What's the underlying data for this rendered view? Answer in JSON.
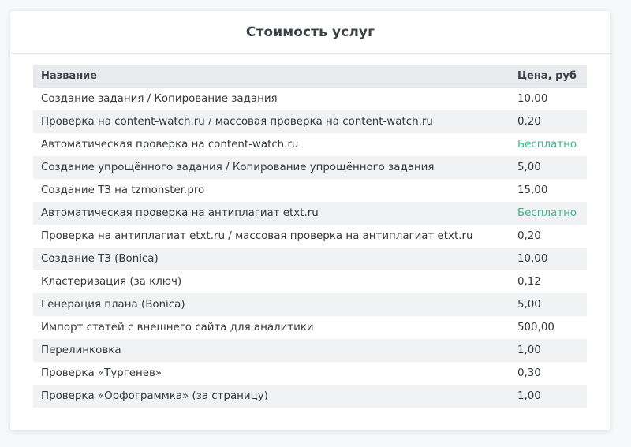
{
  "title": "Стоимость услуг",
  "table": {
    "columns": [
      "Название",
      "Цена, руб"
    ],
    "rows": [
      {
        "name": "Создание задания / Копирование задания",
        "price": "10,00",
        "free": false
      },
      {
        "name": "Проверка на content-watch.ru / массовая проверка на content-watch.ru",
        "price": "0,20",
        "free": false
      },
      {
        "name": "Автоматическая проверка на content-watch.ru",
        "price": "Бесплатно",
        "free": true
      },
      {
        "name": "Создание упрощённого задания / Копирование упрощённого задания",
        "price": "5,00",
        "free": false
      },
      {
        "name": "Создание ТЗ на tzmonster.pro",
        "price": "15,00",
        "free": false
      },
      {
        "name": "Автоматическая проверка на антиплагиат etxt.ru",
        "price": "Бесплатно",
        "free": true
      },
      {
        "name": "Проверка на антиплагиат etxt.ru / массовая проверка на антиплагиат etxt.ru",
        "price": "0,20",
        "free": false
      },
      {
        "name": "Создание ТЗ (Bonica)",
        "price": "10,00",
        "free": false
      },
      {
        "name": "Кластеризация (за ключ)",
        "price": "0,12",
        "free": false
      },
      {
        "name": "Генерация плана (Bonica)",
        "price": "5,00",
        "free": false
      },
      {
        "name": "Импорт статей с внешнего сайта для аналитики",
        "price": "500,00",
        "free": false
      },
      {
        "name": "Перелинковка",
        "price": "1,00",
        "free": false
      },
      {
        "name": "Проверка «Тургенев»",
        "price": "0,30",
        "free": false
      },
      {
        "name": "Проверка «Орфограммка» (за страницу)",
        "price": "1,00",
        "free": false
      }
    ]
  },
  "colors": {
    "free": "#3ab88a",
    "header_bg": "#e8eaed",
    "stripe_bg": "#f1f2f4"
  }
}
